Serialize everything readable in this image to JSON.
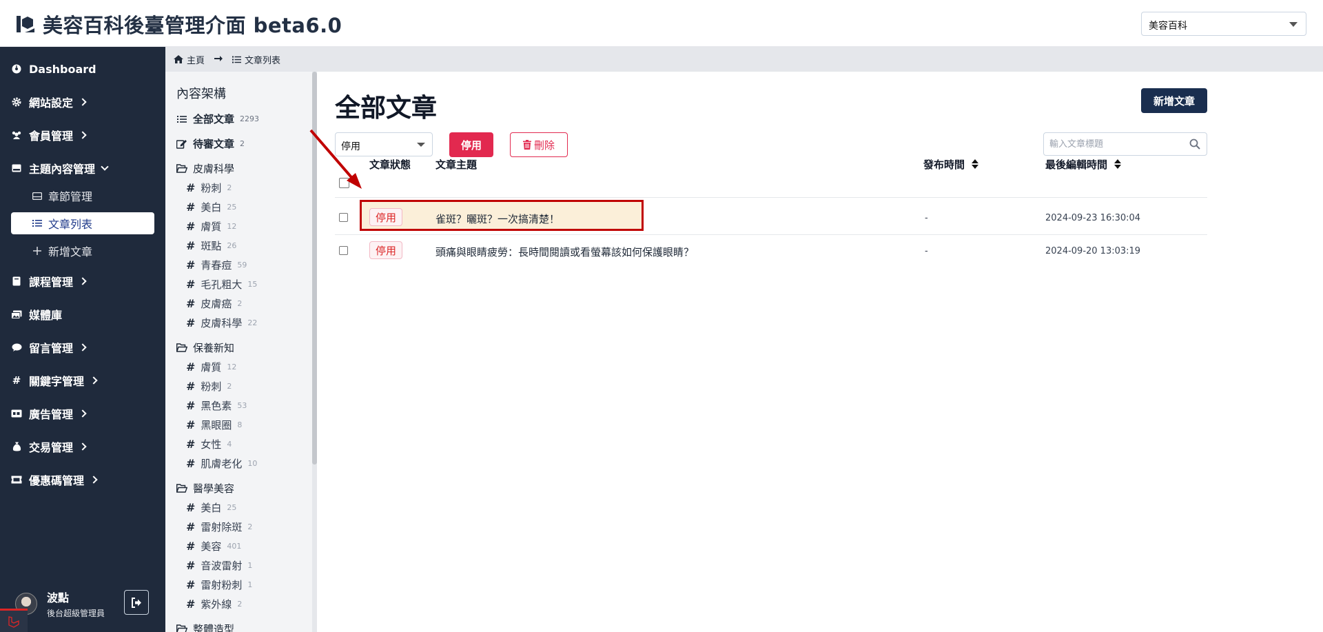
{
  "header": {
    "title": "美容百科後臺管理介面 beta6.0",
    "site_select": "美容百科"
  },
  "sidebar": {
    "items": [
      {
        "label": "Dashboard",
        "icon": "palette-icon"
      },
      {
        "label": "網站設定",
        "icon": "gear-icon"
      },
      {
        "label": "會員管理",
        "icon": "users-icon"
      },
      {
        "label": "主題內容管理",
        "icon": "hdd-icon"
      },
      {
        "label": "課程管理",
        "icon": "book-icon"
      },
      {
        "label": "媒體庫",
        "icon": "images-icon"
      },
      {
        "label": "留言管理",
        "icon": "comment-icon"
      },
      {
        "label": "關鍵字管理",
        "icon": "hash-icon"
      },
      {
        "label": "廣告管理",
        "icon": "ad-icon"
      },
      {
        "label": "交易管理",
        "icon": "money-bag-icon"
      },
      {
        "label": "優惠碼管理",
        "icon": "ticket-icon"
      }
    ],
    "sub_items": [
      {
        "label": "章節管理",
        "icon": "hdd-icon"
      },
      {
        "label": "文章列表",
        "icon": "list-icon"
      },
      {
        "label": "新增文章",
        "icon": "plus-icon"
      }
    ],
    "user": {
      "name": "波點",
      "role": "後台超級管理員"
    }
  },
  "breadcrumb": {
    "home": "主頁",
    "current": "文章列表"
  },
  "categories": {
    "heading": "內容架構",
    "top": [
      {
        "label": "全部文章",
        "count": "2293"
      },
      {
        "label": "待審文章",
        "count": "2"
      }
    ],
    "groups": [
      {
        "name": "皮膚科學",
        "tags": [
          {
            "label": "粉刺",
            "count": "2"
          },
          {
            "label": "美白",
            "count": "25"
          },
          {
            "label": "膚質",
            "count": "12"
          },
          {
            "label": "斑點",
            "count": "26"
          },
          {
            "label": "青春痘",
            "count": "59"
          },
          {
            "label": "毛孔粗大",
            "count": "15"
          },
          {
            "label": "皮膚癌",
            "count": "2"
          },
          {
            "label": "皮膚科學",
            "count": "22"
          }
        ]
      },
      {
        "name": "保養新知",
        "tags": [
          {
            "label": "膚質",
            "count": "12"
          },
          {
            "label": "粉刺",
            "count": "2"
          },
          {
            "label": "黑色素",
            "count": "53"
          },
          {
            "label": "黑眼圈",
            "count": "8"
          },
          {
            "label": "女性",
            "count": "4"
          },
          {
            "label": "肌膚老化",
            "count": "10"
          }
        ]
      },
      {
        "name": "醫學美容",
        "tags": [
          {
            "label": "美白",
            "count": "25"
          },
          {
            "label": "雷射除斑",
            "count": "2"
          },
          {
            "label": "美容",
            "count": "401"
          },
          {
            "label": "音波雷射",
            "count": "1"
          },
          {
            "label": "雷射粉刺",
            "count": "1"
          },
          {
            "label": "紫外線",
            "count": "2"
          }
        ]
      },
      {
        "name": "整體造型",
        "tags": []
      }
    ]
  },
  "main": {
    "title": "全部文章",
    "new_button": "新增文章",
    "status_select": "停用",
    "disable_button": "停用",
    "delete_button": "刪除",
    "search_placeholder": "輸入文章標題",
    "columns": {
      "status": "文章狀態",
      "subject": "文章主題",
      "published": "發布時間",
      "edited": "最後編輯時間"
    },
    "rows": [
      {
        "status": "停用",
        "subject": "雀斑？曬斑？一次搞清楚！",
        "published": "-",
        "edited": "2024-09-23 16:30:04"
      },
      {
        "status": "停用",
        "subject": "頭痛與眼睛疲勞：長時間閱讀或看螢幕該如何保護眼睛？",
        "published": "-",
        "edited": "2024-09-20 13:03:19"
      }
    ]
  },
  "colors": {
    "sidebar_bg": "#1f2a3c",
    "primary_dark": "#1a2e4f",
    "danger": "#e2294f",
    "highlight_border": "#c00000",
    "highlight_fill": "#fbefd9"
  }
}
